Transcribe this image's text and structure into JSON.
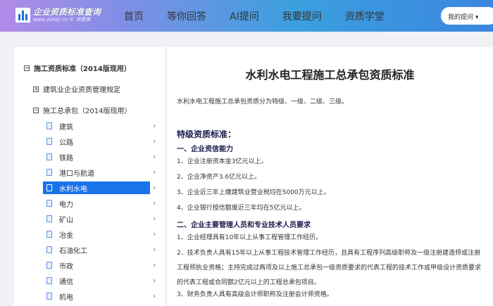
{
  "header": {
    "logo_title": "企业资质标准查询",
    "logo_sub": "www.zizhiji.cn © 资质果",
    "nav": [
      "首页",
      "等你回答",
      "AI提问",
      "我要提问",
      "资质学堂"
    ],
    "my_questions": "我的提问 ▾"
  },
  "sidebar": {
    "root": "施工资质标准（2014版现用）",
    "node1": "建筑业企业资质管理规定",
    "node2": "施工总承包（2014版现用）",
    "leaves": [
      "建筑",
      "公路",
      "铁路",
      "港口与航道",
      "水利水电",
      "电力",
      "矿山",
      "冶金",
      "石油化工",
      "市政",
      "通信",
      "机电"
    ],
    "active_index": 4
  },
  "content": {
    "title": "水利水电工程施工总承包资质标准",
    "intro": "水利水电工程施工总承包资质分为特级、一级、二级、三级。",
    "grade": "特级资质标准：",
    "sec1": "一、企业资信能力",
    "sec1_items": [
      "1、企业注册资本金3亿元以上。",
      "2、企业净资产3.6亿元以上。",
      "3、企业近三年上缴建筑业营业税均在5000万元以上。",
      "4、企业银行授信额度近三年均在5亿元以上。"
    ],
    "sec2": "二、企业主要管理人员和专业技术人员要求",
    "sec2_items": [
      "1、企业经理具有10年以上从事工程管理工作经历。",
      "2、技术负责人具有15年以上从事工程技术管理工作经历，且具有工程序列高级职称及一级注册建造师或注册工程师执业资格；主持完成过两项及以上施工总承包一级资质要求的代表工程的技术工作或甲级设计资质要求的代表工程或合同额2亿元以上的工程总承包项目。",
      "3、财务负责人具有高级会计师职称及注册会计师资格。"
    ]
  }
}
